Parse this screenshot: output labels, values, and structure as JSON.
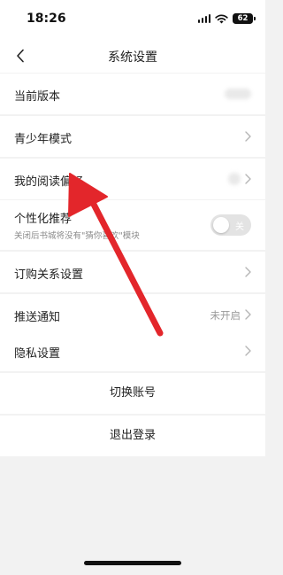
{
  "status_bar": {
    "time": "18:26",
    "battery": "62",
    "icons": [
      "signal-icon",
      "wifi-icon",
      "battery-icon"
    ]
  },
  "header": {
    "title": "系统设置",
    "back_icon": "chevron-left-icon"
  },
  "settings": {
    "current_version": {
      "label": "当前版本"
    },
    "teen_mode": {
      "label": "青少年模式"
    },
    "reading_pref": {
      "label": "我的阅读偏好"
    },
    "personalized": {
      "label": "个性化推荐",
      "sublabel": "关闭后书城将没有\"猜你喜欢\"模块",
      "toggle_text": "关",
      "enabled": false
    },
    "subscription": {
      "label": "订购关系设置"
    },
    "push": {
      "label": "推送通知",
      "value": "未开启"
    },
    "privacy": {
      "label": "隐私设置"
    }
  },
  "actions": {
    "switch_account": "切换账号",
    "logout": "退出登录"
  },
  "colors": {
    "background": "#f2f2f2",
    "annotation_arrow": "#e3262b",
    "muted_text": "#9a9a9a"
  }
}
